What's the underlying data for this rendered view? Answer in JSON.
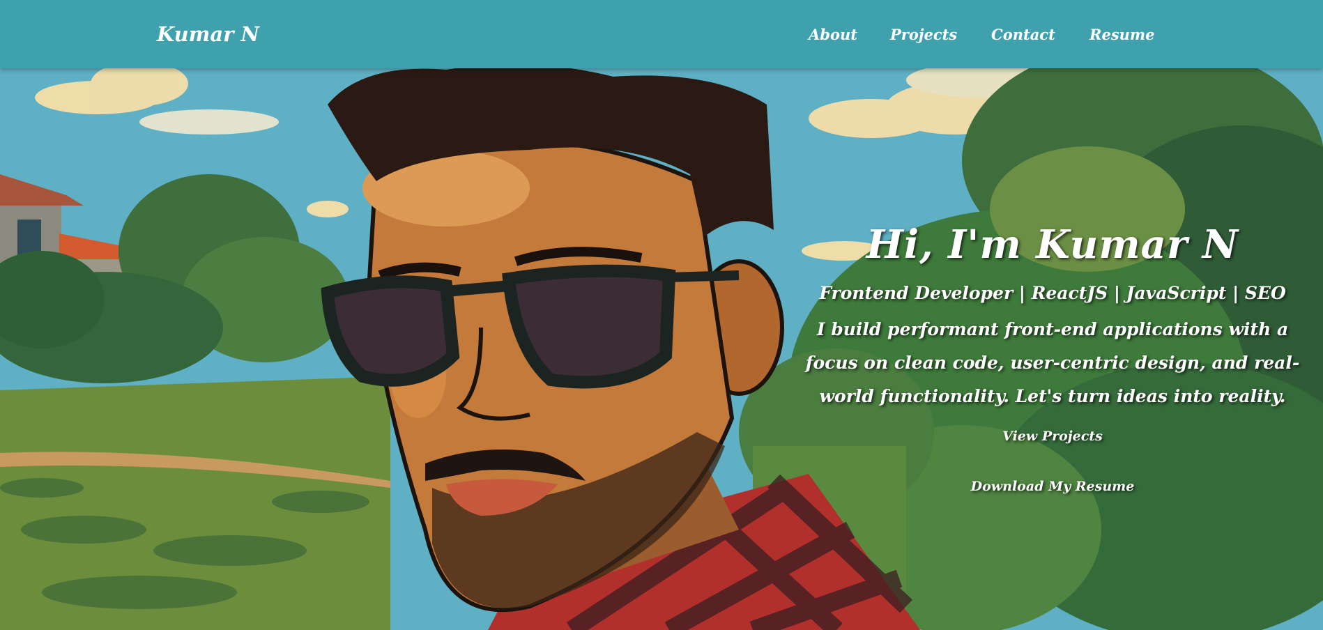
{
  "header": {
    "logo": "Kumar N",
    "nav": [
      "About",
      "Projects",
      "Contact",
      "Resume"
    ]
  },
  "hero": {
    "heading": "Hi, I'm Kumar N",
    "tagline": "Frontend Developer | ReactJS | JavaScript | SEO",
    "description": "I build performant front-end applications with a focus on clean code, user-centric design, and real-world functionality. Let's turn ideas into reality.",
    "cta_projects": "View Projects",
    "cta_resume": "Download My Resume"
  },
  "colors": {
    "header_bg": "#3fa1ae",
    "text": "#ffffff",
    "sky": "#5fb0c4",
    "foliage": "#3e7a3b",
    "shirt_red": "#b2302c"
  },
  "icons": [
    "portrait-illustration"
  ]
}
